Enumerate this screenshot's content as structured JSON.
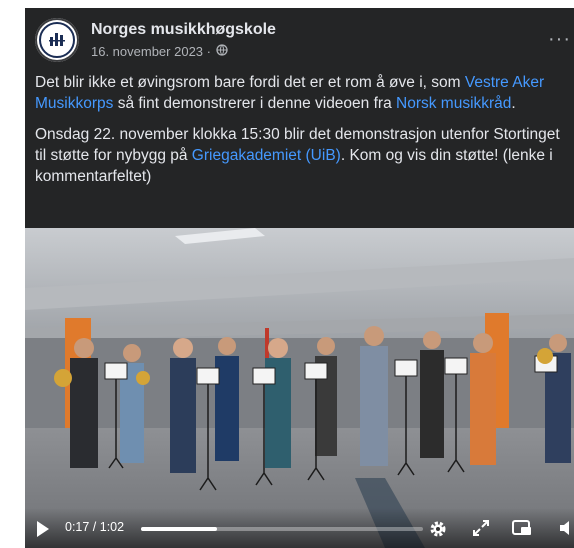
{
  "post": {
    "page_name": "Norges musikkhøgskole",
    "date": "16. november 2023 ·",
    "privacy_icon": "globe-icon",
    "more_label": "···",
    "paragraph1": {
      "text_a": "Det blir ikke et øvingsrom bare fordi det er et rom å øve i, som ",
      "link_a": "Vestre Aker Musikkorps",
      "text_b": " så fint demonstrerer i denne videoen fra ",
      "link_b": "Norsk musikkråd",
      "text_c": "."
    },
    "paragraph2": {
      "text_a": "Onsdag 22. november klokka 15:30 blir det demonstrasjon utenfor Stortinget til støtte for nybygg på ",
      "link_a": "Griegakademiet (UiB)",
      "text_b": ". Kom og vis din støtte! (lenke i kommentarfeltet)"
    }
  },
  "video": {
    "time_display": "0:17 / 1:02",
    "progress_fraction": 0.27,
    "icons": [
      "play-icon",
      "settings-gear-icon",
      "fullscreen-expand-icon",
      "picture-in-picture-icon",
      "volume-icon"
    ]
  },
  "colors": {
    "card_bg": "#242526",
    "link": "#4599ff",
    "text": "#e4e6eb",
    "secondary": "#b0b3b8"
  }
}
